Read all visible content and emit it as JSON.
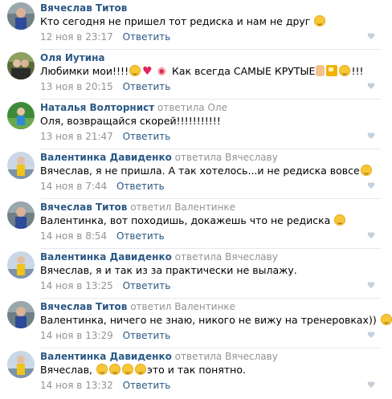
{
  "comments": [
    {
      "author": "Вячеслав Титов",
      "reply_word": "",
      "reply_to": "",
      "text": "Кто сегодня не пришел тот редиска и нам не друг",
      "emojis_after": [
        "smiley-face-icon"
      ],
      "date": "12 ноя в 23:17",
      "reply_label": "Ответить"
    },
    {
      "author": "Оля Иутина",
      "reply_word": "",
      "reply_to": "",
      "text_part1": "Любимки мои!!!!",
      "text_part2": "Как всегда САМЫЕ КРУТЫЕ",
      "text_part3": "!!!",
      "date": "13 ноя в 20:15",
      "reply_label": "Ответить"
    },
    {
      "author": "Наталья Волторнист",
      "reply_word": "ответила",
      "reply_to": "Оле",
      "text": "Оля, возвращайся скорей!!!!!!!!!!!",
      "date": "13 ноя в 21:47",
      "reply_label": "Ответить"
    },
    {
      "author": "Валентинка Давиденко",
      "reply_word": "ответила",
      "reply_to": "Вячеславу",
      "text": "Вячеслав, я не пришла. А так хотелось...и не редиска вовсе",
      "date": "14 ноя в 7:44",
      "reply_label": "Ответить"
    },
    {
      "author": "Вячеслав Титов",
      "reply_word": "ответил",
      "reply_to": "Валентинке",
      "text": "Валентинка, вот походишь, докажешь что не редиска",
      "date": "14 ноя в 8:54",
      "reply_label": "Ответить"
    },
    {
      "author": "Валентинка Давиденко",
      "reply_word": "ответила",
      "reply_to": "Вячеславу",
      "text": "Вячеслав, я и так из за практически не вылажу.",
      "date": "14 ноя в 13:25",
      "reply_label": "Ответить"
    },
    {
      "author": "Вячеслав Титов",
      "reply_word": "ответил",
      "reply_to": "Валентинке",
      "text": "Валентинка, ничего не знаю, никого не вижу на тренеровках))",
      "date": "14 ноя в 13:29",
      "reply_label": "Ответить"
    },
    {
      "author": "Валентинка Давиденко",
      "reply_word": "ответила",
      "reply_to": "Вячеславу",
      "text_part1": "Вячеслав,",
      "text_part2": "это и так понятно.",
      "date": "14 ноя в 13:32",
      "reply_label": "Ответить"
    }
  ],
  "colors": {
    "author": "#2a5885",
    "muted": "#939393",
    "separator": "#e7e8ec",
    "like_icon": "#c5d0db"
  }
}
